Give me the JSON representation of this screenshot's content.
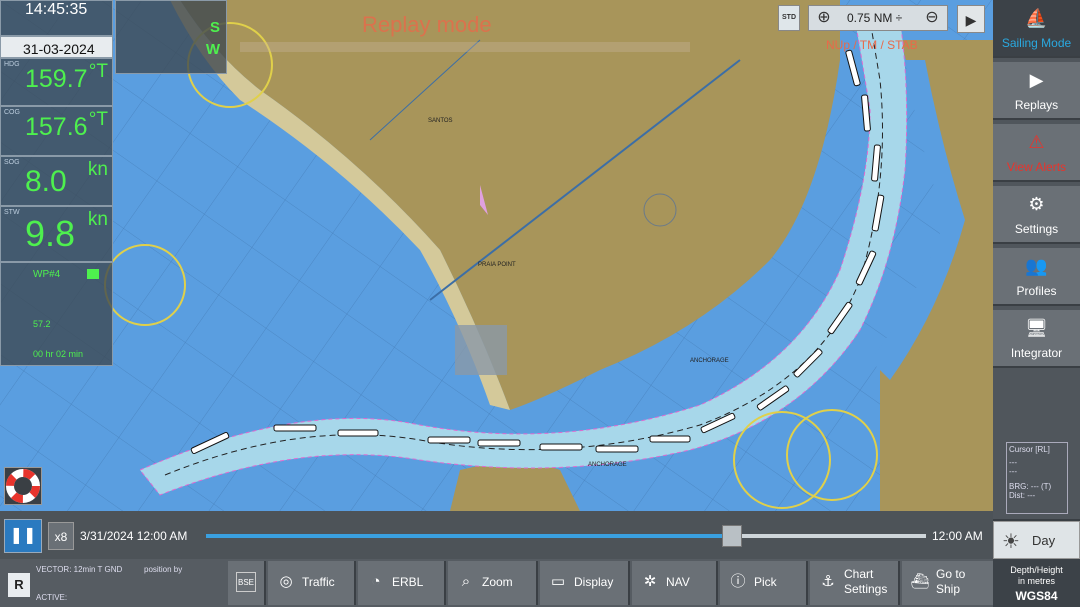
{
  "overlay": {
    "mode_title": "Replay mode",
    "orientation": "NUp / TM / STAB"
  },
  "left_panel": {
    "time": "14:45:35",
    "date": "31-03-2024",
    "hdg": {
      "label": "HDG",
      "value": "159.7",
      "unit": "°T"
    },
    "cog": {
      "label": "COG",
      "value": "157.6",
      "unit": "°T"
    },
    "sog": {
      "label": "SOG",
      "value": "8.0",
      "unit": "kn"
    },
    "stw": {
      "label": "STW",
      "value": "9.8",
      "unit": "kn"
    },
    "wpt": {
      "name": "WP#4",
      "atd": "57.2",
      "ttg": "00 hr 02 min"
    }
  },
  "position": {
    "lat_hem": "S",
    "lon_hem": "W"
  },
  "zoom": {
    "std_label": "STD",
    "range": "0.75 NM ÷"
  },
  "sidebar": {
    "sailing": "Sailing Mode",
    "replays": "Replays",
    "alerts": "View Alerts",
    "settings": "Settings",
    "profiles": "Profiles",
    "integrator": "Integrator"
  },
  "cursor": {
    "title": "Cursor [RL]",
    "v1": "---",
    "v2": "---",
    "brg": "BRG: --- (T)",
    "dist": "Dist: ---"
  },
  "timeline": {
    "speed": "x8",
    "start": "3/31/2024 12:00 AM",
    "end": "12:00 AM",
    "progress": 0.73
  },
  "day": {
    "label": "Day"
  },
  "vector": {
    "line1": "VECTOR: 12min T GND",
    "line2": "ACTIVE:",
    "pos_label": "position by"
  },
  "toolbar": {
    "traffic": "Traffic",
    "erbl": "ERBL",
    "zoom": "Zoom",
    "display": "Display",
    "nav": "NAV",
    "pick": "Pick",
    "chart_settings_1": "Chart",
    "chart_settings_2": "Settings",
    "goto_1": "Go to",
    "goto_2": "Ship"
  },
  "depth": {
    "l1": "Depth/Height",
    "l2": "in metres",
    "l3": "WGS84"
  },
  "chart_labels": {
    "anchorage_1": "ANCHORAGE",
    "anchorage_2": "ANCHORAGE",
    "praia": "PRAIA POINT",
    "santos": "SANTOS"
  },
  "colors": {
    "accent": "#2aa9e0",
    "alert": "#e8342c",
    "readout": "#4ef04e",
    "land": "#a8955a",
    "shoal": "#a7d7ea",
    "water": "#5a9ee0"
  }
}
